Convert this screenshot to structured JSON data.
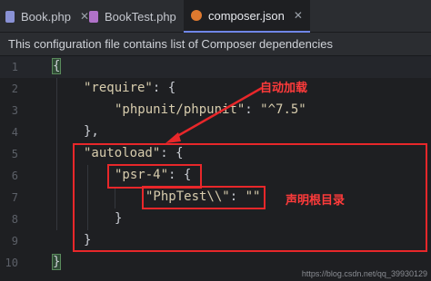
{
  "tabs": [
    {
      "label": "Book.php",
      "icon": "php-file-icon",
      "close": "✕"
    },
    {
      "label": "BookTest.php",
      "icon": "phpunit-file-icon",
      "close": "✕"
    },
    {
      "label": "composer.json",
      "icon": "composer-icon",
      "close": "✕",
      "active": true
    }
  ],
  "info_bar": {
    "text": "This configuration file contains list of Composer dependencies"
  },
  "gutter": [
    "1",
    "2",
    "3",
    "4",
    "5",
    "6",
    "7",
    "8",
    "9",
    "10"
  ],
  "code": {
    "l1_brace": "{",
    "l2_key": "\"require\"",
    "l2_rest": ": {",
    "l3_key": "\"phpunit/phpunit\"",
    "l3_sep": ": ",
    "l3_val": "\"^7.5\"",
    "l4": "},",
    "l5_key": "\"autoload\"",
    "l5_rest": ": {",
    "l6_key": "\"psr-4\"",
    "l6_rest": ": {",
    "l7_key": "\"PhpTest\\\\\"",
    "l7_sep": ": ",
    "l7_val": "\"\"",
    "l8": "}",
    "l9": "}",
    "l10_brace": "}"
  },
  "annotations": {
    "autoload_label": "自动加载",
    "namespace_label": "声明根目录"
  },
  "watermark": "https://blog.csdn.net/qq_39930129",
  "colors": {
    "annotation": "#e8272a",
    "string": "#d7ccad",
    "tab_accent": "#6f86e8"
  }
}
